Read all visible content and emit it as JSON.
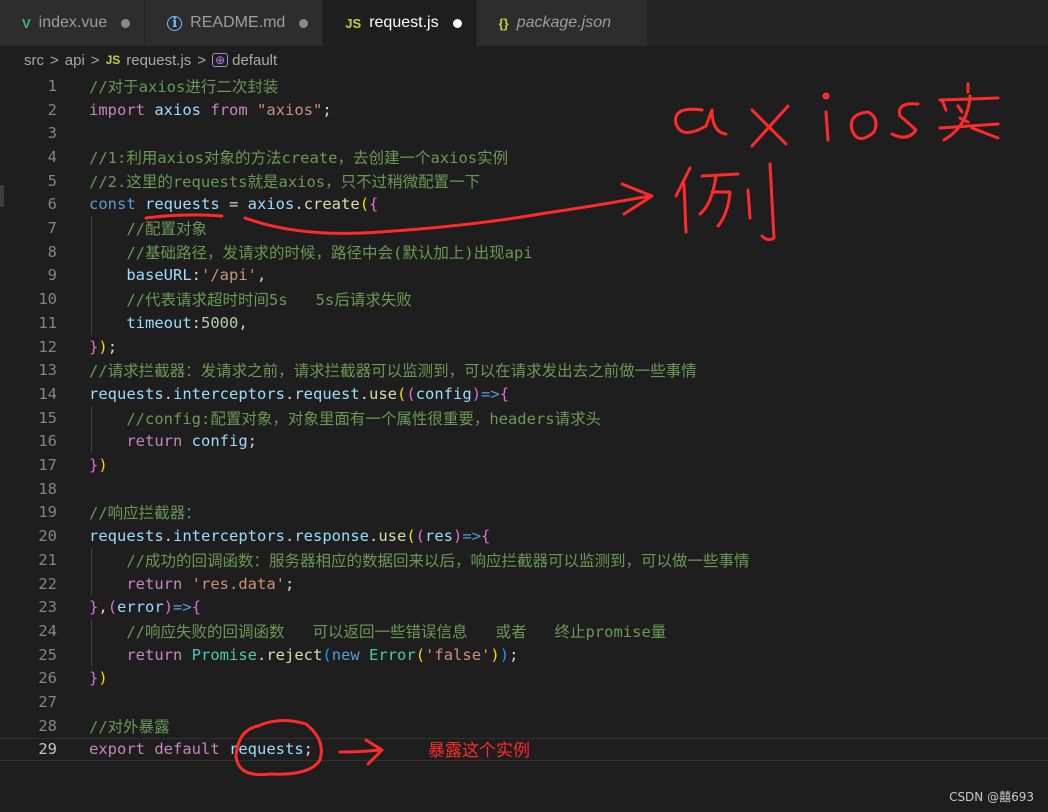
{
  "tabs": [
    {
      "label": "index.vue",
      "icon": "vue-icon",
      "modified": true
    },
    {
      "label": "README.md",
      "icon": "info-icon",
      "modified": true
    },
    {
      "label": "request.js",
      "icon": "js-icon",
      "modified": true,
      "active": true
    },
    {
      "label": "package.json",
      "icon": "json-icon",
      "modified": false
    }
  ],
  "tab_icons": {
    "vue": "V",
    "info": "i",
    "js": "JS",
    "json": "{}"
  },
  "breadcrumb": {
    "parts": [
      "src",
      "api",
      "request.js",
      "default"
    ],
    "sep": ">",
    "js_badge": "JS",
    "symbol_badge": "⊕"
  },
  "editor": {
    "current_line": 29,
    "lines": [
      {
        "n": "1",
        "tokens": [
          [
            "cm",
            "//对于axios进行二次封装"
          ]
        ]
      },
      {
        "n": "2",
        "tokens": [
          [
            "kw",
            "import"
          ],
          [
            "pun",
            " "
          ],
          [
            "var",
            "axios"
          ],
          [
            "pun",
            " "
          ],
          [
            "kw",
            "from"
          ],
          [
            "pun",
            " "
          ],
          [
            "str",
            "\"axios\""
          ],
          [
            "pun",
            ";"
          ]
        ]
      },
      {
        "n": "3",
        "tokens": []
      },
      {
        "n": "4",
        "tokens": [
          [
            "cm",
            "//1:利用axios对象的方法create，去创建一个axios实例"
          ]
        ]
      },
      {
        "n": "5",
        "tokens": [
          [
            "cm",
            "//2.这里的requests就是axios，只不过稍微配置一下"
          ]
        ]
      },
      {
        "n": "6",
        "tokens": [
          [
            "st",
            "const"
          ],
          [
            "pun",
            " "
          ],
          [
            "var",
            "requests"
          ],
          [
            "pun",
            " = "
          ],
          [
            "var",
            "axios"
          ],
          [
            "pun",
            "."
          ],
          [
            "fn",
            "create"
          ],
          [
            "br1",
            "("
          ],
          [
            "br2",
            "{"
          ]
        ]
      },
      {
        "n": "7",
        "tokens": [
          [
            "pun",
            "    "
          ],
          [
            "cm",
            "//配置对象"
          ]
        ]
      },
      {
        "n": "8",
        "tokens": [
          [
            "pun",
            "    "
          ],
          [
            "cm",
            "//基础路径，发请求的时候，路径中会(默认加上)出现api"
          ]
        ]
      },
      {
        "n": "9",
        "tokens": [
          [
            "pun",
            "    "
          ],
          [
            "var",
            "baseURL"
          ],
          [
            "pun",
            ":"
          ],
          [
            "str",
            "'/api'"
          ],
          [
            "pun",
            ","
          ]
        ]
      },
      {
        "n": "10",
        "tokens": [
          [
            "pun",
            "    "
          ],
          [
            "cm",
            "//代表请求超时时间5s   5s后请求失败"
          ]
        ]
      },
      {
        "n": "11",
        "tokens": [
          [
            "pun",
            "    "
          ],
          [
            "var",
            "timeout"
          ],
          [
            "pun",
            ":"
          ],
          [
            "num",
            "5000"
          ],
          [
            "pun",
            ","
          ]
        ]
      },
      {
        "n": "12",
        "tokens": [
          [
            "br2",
            "}"
          ],
          [
            "br1",
            ")"
          ],
          [
            "pun",
            ";"
          ]
        ]
      },
      {
        "n": "13",
        "tokens": [
          [
            "cm",
            "//请求拦截器：发请求之前，请求拦截器可以监测到，可以在请求发出去之前做一些事情"
          ]
        ]
      },
      {
        "n": "14",
        "tokens": [
          [
            "var",
            "requests"
          ],
          [
            "pun",
            "."
          ],
          [
            "var",
            "interceptors"
          ],
          [
            "pun",
            "."
          ],
          [
            "var",
            "request"
          ],
          [
            "pun",
            "."
          ],
          [
            "fn",
            "use"
          ],
          [
            "br1",
            "("
          ],
          [
            "br2",
            "("
          ],
          [
            "var",
            "config"
          ],
          [
            "br2",
            ")"
          ],
          [
            "st",
            "=>"
          ],
          [
            "br2",
            "{"
          ]
        ]
      },
      {
        "n": "15",
        "tokens": [
          [
            "pun",
            "    "
          ],
          [
            "cm",
            "//config:配置对象，对象里面有一个属性很重要，headers请求头"
          ]
        ]
      },
      {
        "n": "16",
        "tokens": [
          [
            "pun",
            "    "
          ],
          [
            "kw",
            "return"
          ],
          [
            "pun",
            " "
          ],
          [
            "var",
            "config"
          ],
          [
            "pun",
            ";"
          ]
        ]
      },
      {
        "n": "17",
        "tokens": [
          [
            "br2",
            "}"
          ],
          [
            "br1",
            ")"
          ]
        ]
      },
      {
        "n": "18",
        "tokens": []
      },
      {
        "n": "19",
        "tokens": [
          [
            "cm",
            "//响应拦截器："
          ]
        ]
      },
      {
        "n": "20",
        "tokens": [
          [
            "var",
            "requests"
          ],
          [
            "pun",
            "."
          ],
          [
            "var",
            "interceptors"
          ],
          [
            "pun",
            "."
          ],
          [
            "var",
            "response"
          ],
          [
            "pun",
            "."
          ],
          [
            "fn",
            "use"
          ],
          [
            "br1",
            "("
          ],
          [
            "br2",
            "("
          ],
          [
            "var",
            "res"
          ],
          [
            "br2",
            ")"
          ],
          [
            "st",
            "=>"
          ],
          [
            "br2",
            "{"
          ]
        ]
      },
      {
        "n": "21",
        "tokens": [
          [
            "pun",
            "    "
          ],
          [
            "cm",
            "//成功的回调函数：服务器相应的数据回来以后，响应拦截器可以监测到，可以做一些事情"
          ]
        ]
      },
      {
        "n": "22",
        "tokens": [
          [
            "pun",
            "    "
          ],
          [
            "kw",
            "return"
          ],
          [
            "pun",
            " "
          ],
          [
            "str",
            "'res.data'"
          ],
          [
            "pun",
            ";"
          ]
        ]
      },
      {
        "n": "23",
        "tokens": [
          [
            "br2",
            "}"
          ],
          [
            "pun",
            ","
          ],
          [
            "br2",
            "("
          ],
          [
            "var",
            "error"
          ],
          [
            "br2",
            ")"
          ],
          [
            "st",
            "=>"
          ],
          [
            "br2",
            "{"
          ]
        ]
      },
      {
        "n": "24",
        "tokens": [
          [
            "pun",
            "    "
          ],
          [
            "cm",
            "//响应失败的回调函数   可以返回一些错误信息   或者   终止promise量"
          ]
        ]
      },
      {
        "n": "25",
        "tokens": [
          [
            "pun",
            "    "
          ],
          [
            "kw",
            "return"
          ],
          [
            "pun",
            " "
          ],
          [
            "cls",
            "Promise"
          ],
          [
            "pun",
            "."
          ],
          [
            "fn",
            "reject"
          ],
          [
            "br3",
            "("
          ],
          [
            "st",
            "new"
          ],
          [
            "pun",
            " "
          ],
          [
            "cls",
            "Error"
          ],
          [
            "br1",
            "("
          ],
          [
            "str",
            "'false'"
          ],
          [
            "br1",
            ")"
          ],
          [
            "br3",
            ")"
          ],
          [
            "pun",
            ";"
          ]
        ]
      },
      {
        "n": "26",
        "tokens": [
          [
            "br2",
            "}"
          ],
          [
            "br1",
            ")"
          ]
        ]
      },
      {
        "n": "27",
        "tokens": []
      },
      {
        "n": "28",
        "tokens": [
          [
            "cm",
            "//对外暴露"
          ]
        ]
      },
      {
        "n": "29",
        "tokens": [
          [
            "kw",
            "export"
          ],
          [
            "pun",
            " "
          ],
          [
            "kw",
            "default"
          ],
          [
            "pun",
            " "
          ],
          [
            "var",
            "requests"
          ],
          [
            "pun",
            ";"
          ]
        ]
      }
    ]
  },
  "annotations": {
    "handwritten_top": "axios实例",
    "note_bottom": "暴露这个实例",
    "color": "#ff2a2a"
  },
  "watermark": "CSDN @囍693",
  "colors": {
    "background": "#1e1e1e",
    "tabbar": "#252526",
    "comment": "#6a9955",
    "keyword": "#c586c0",
    "string": "#ce9178"
  }
}
